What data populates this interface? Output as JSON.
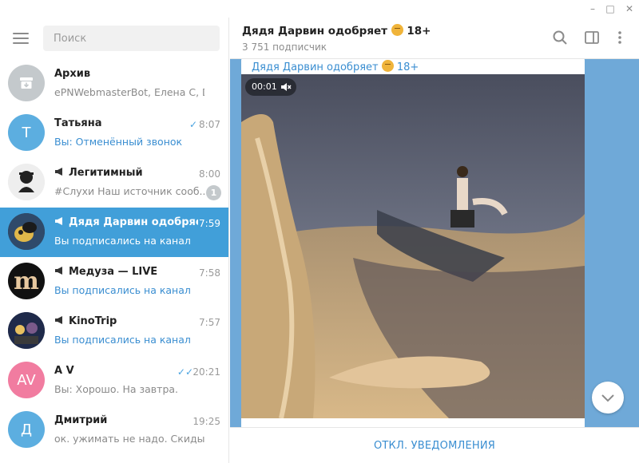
{
  "window": {
    "minimize": "–",
    "maximize": "□",
    "close": "✕"
  },
  "sidebar": {
    "search_placeholder": "Поиск",
    "chats": [
      {
        "name": "Архив",
        "preview": "ePNWebmasterBot, Елена C, Dov...",
        "time": "",
        "avatar_text": "",
        "avatar_color": "#c4c9cc"
      },
      {
        "name": "Татьяна",
        "preview": "Вы: Отменённый звонок",
        "time": "8:07",
        "avatar_text": "T",
        "avatar_color": "#5caee0"
      },
      {
        "name": "Легитимный",
        "preview": "#Слухи  Наш источник сооб...",
        "time": "8:00",
        "badge": "1",
        "avatar_text": "",
        "avatar_color": "#e8e8e8"
      },
      {
        "name": "Дядя Дарвин одобряе...",
        "preview": "Вы подписались на канал",
        "time": "7:59",
        "avatar_text": "",
        "avatar_color": "#2a3a4a"
      },
      {
        "name": "Медуза — LIVE",
        "preview": "Вы подписались на канал",
        "time": "7:58",
        "avatar_text": "m",
        "avatar_color": "#111111"
      },
      {
        "name": "KinoTrip",
        "preview": "Вы подписались на канал",
        "time": "7:57",
        "avatar_text": "",
        "avatar_color": "#1f2a4a"
      },
      {
        "name": "A V",
        "preview": "Вы: Хорошо. На завтра.",
        "time": "20:21",
        "avatar_text": "AV",
        "avatar_color": "#f17ca0"
      },
      {
        "name": "Дмитрий",
        "preview": "ок. ужимать не надо. Скидывай...",
        "time": "19:25",
        "avatar_text": "Д",
        "avatar_color": "#5caee0"
      }
    ]
  },
  "header": {
    "title": "Дядя Дарвин одобряет",
    "title_suffix": "18+",
    "subtitle": "3 751 подписчик"
  },
  "message": {
    "sender": "Дядя Дарвин одобряет",
    "sender_suffix": "18+",
    "video_time": "00:01"
  },
  "bottom": {
    "mute_label": "ОТКЛ. УВЕДОМЛЕНИЯ"
  },
  "colors": {
    "accent": "#419fd9",
    "link": "#3a8ed1",
    "chat_bg": "#6fa9d8"
  },
  "icons": [
    "menu-icon",
    "archive-icon",
    "megaphone-icon",
    "check-icon",
    "double-check-icon",
    "search-icon",
    "sidebar-toggle-icon",
    "more-vertical-icon",
    "mute-icon",
    "chevron-down-icon"
  ]
}
